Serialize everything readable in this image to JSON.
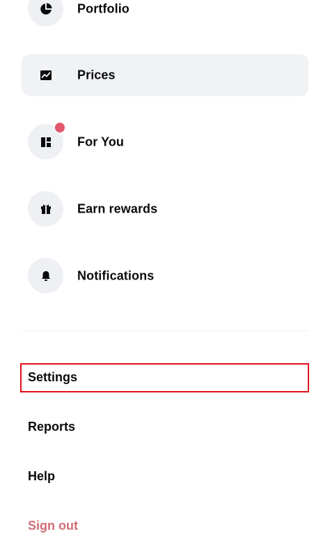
{
  "nav": {
    "items": [
      {
        "label": "Portfolio",
        "icon": "pie-chart-icon",
        "active": false
      },
      {
        "label": "Prices",
        "icon": "line-chart-icon",
        "active": true
      },
      {
        "label": "For You",
        "icon": "layout-icon",
        "active": false,
        "badge": true
      },
      {
        "label": "Earn rewards",
        "icon": "gift-icon",
        "active": false
      },
      {
        "label": "Notifications",
        "icon": "bell-icon",
        "active": false
      }
    ]
  },
  "secondary": {
    "settings": "Settings",
    "reports": "Reports",
    "help": "Help",
    "sign_out": "Sign out"
  },
  "colors": {
    "text": "#0a0b0d",
    "active_bg": "#f1f2f4",
    "icon_circle_bg": "#eef0f3",
    "badge": "#e0596a",
    "sign_out": "#d26d77",
    "highlight_border": "#e0101a"
  }
}
